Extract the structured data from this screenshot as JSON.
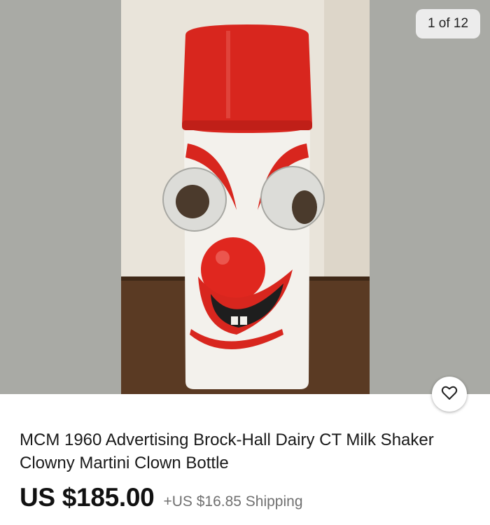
{
  "gallery": {
    "counter": "1 of 12",
    "image_alt": "Red and white clown face thermos bottle with googly eyes",
    "favorite_icon": "heart-icon"
  },
  "listing": {
    "title": "MCM 1960 Advertising Brock-Hall Dairy CT Milk Shaker Clowny Martini Clown Bottle",
    "price": "US $185.00",
    "shipping": "+US $16.85 Shipping"
  },
  "colors": {
    "gallery_background": "#a9aaa5",
    "price_text": "#111111",
    "shipping_text": "#707070"
  }
}
